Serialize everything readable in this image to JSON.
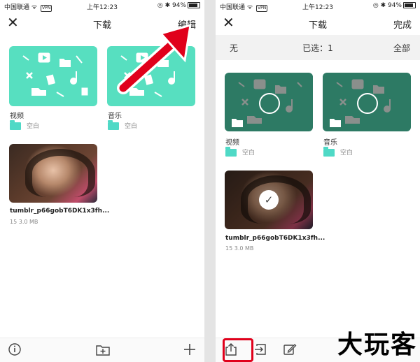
{
  "status": {
    "carrier": "中国联通",
    "vpn": "VPN",
    "time": "上午12:23",
    "battery": "94%"
  },
  "left": {
    "title": "下载",
    "edit_label": "编辑",
    "folders": [
      {
        "name": "视频",
        "sub": "空白"
      },
      {
        "name": "音乐",
        "sub": "空白"
      }
    ],
    "file": {
      "name": "tumblr_p66gobT6DK1x3fh...",
      "meta": "15  3.0 MB"
    }
  },
  "right": {
    "title": "下载",
    "done_label": "完成",
    "select_none": "无",
    "selected_count": "已选：1",
    "select_all": "全部",
    "folders": [
      {
        "name": "视频",
        "sub": "空白"
      },
      {
        "name": "音乐",
        "sub": "空白"
      }
    ],
    "file": {
      "name": "tumblr_p66gobT6DK1x3fh...",
      "meta": "15  3.0 MB"
    }
  },
  "watermark": "大玩客",
  "colors": {
    "teal": "#57dfc0",
    "selected_dark": "#2d7a64",
    "arrow_red": "#e0001b"
  },
  "icons": [
    "close-icon",
    "info-icon",
    "new-folder-icon",
    "add-icon",
    "share-icon",
    "move-icon",
    "edit-icon",
    "checkmark-icon",
    "folder-icon"
  ]
}
